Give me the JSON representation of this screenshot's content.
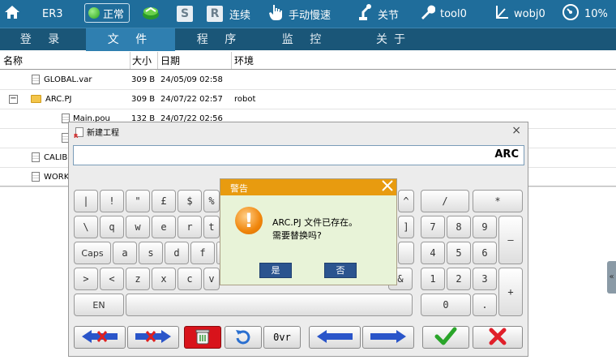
{
  "topbar": {
    "robot": "ER3",
    "status": "正常",
    "mode_s": "S",
    "mode_r": "R",
    "run_mode": "连续",
    "speed_mode": "手动慢速",
    "coord": "关节",
    "tool": "tool0",
    "wobj": "wobj0",
    "speed_pct": "10%"
  },
  "nav": {
    "tabs": [
      "登 录",
      "文 件",
      "程 序",
      "监 控",
      "关于"
    ],
    "active": 1
  },
  "table": {
    "headers": [
      "名称",
      "大小",
      "日期",
      "环境"
    ],
    "rows": [
      {
        "name": "GLOBAL.var",
        "size": "309 B",
        "date": "24/05/09 02:58",
        "env": ""
      },
      {
        "name": "ARC.PJ",
        "size": "309 B",
        "date": "24/07/22 02:57",
        "env": "robot"
      },
      {
        "name": "Main.pou",
        "size": "132 B",
        "date": "24/07/22 02:56",
        "env": ""
      },
      {
        "name": "",
        "size": "",
        "date": "",
        "env": ""
      },
      {
        "name": "CALIB",
        "size": "",
        "date": "",
        "env": ""
      },
      {
        "name": "WORK_",
        "size": "",
        "date": "",
        "env": ""
      }
    ]
  },
  "dialog": {
    "title": "新建工程",
    "close": "×",
    "input_value": "ARC",
    "keys": {
      "row1": [
        "|",
        "!",
        "\"",
        "£",
        "$",
        "%"
      ],
      "row2": [
        "\\",
        "q",
        "w",
        "e",
        "r",
        "t"
      ],
      "row3": [
        "Caps",
        "a",
        "s",
        "d",
        "f"
      ],
      "row4": [
        ">",
        "<",
        "z",
        "x",
        "c",
        "v"
      ],
      "row5": [
        "EN"
      ],
      "right_frag": [
        "^",
        "]",
        "&"
      ],
      "numpad": [
        "/",
        "*",
        "7",
        "8",
        "9",
        "–",
        "4",
        "5",
        "6",
        "1",
        "2",
        "3",
        "+",
        "0",
        "."
      ]
    },
    "ovr": "0vr"
  },
  "warning": {
    "title": "警告",
    "line1": "ARC.PJ 文件已存在。",
    "line2": "需要替换吗?",
    "yes": "是",
    "no": "否"
  }
}
